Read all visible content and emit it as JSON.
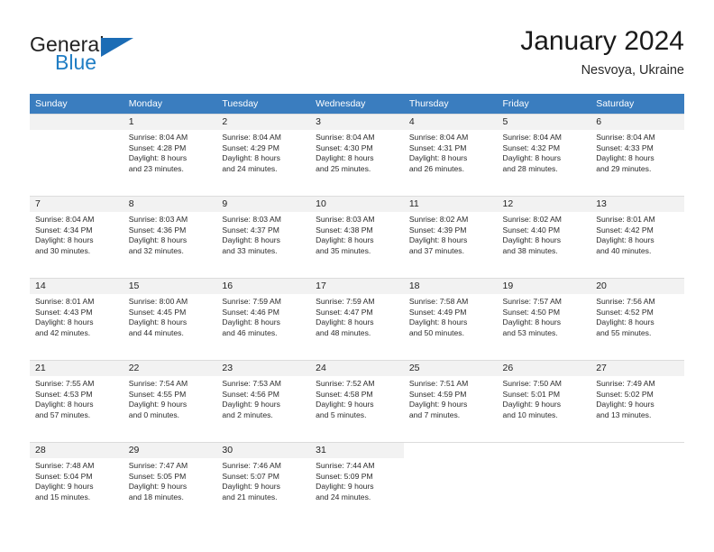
{
  "brand": {
    "name_top": "General",
    "name_bottom": "Blue",
    "triangle_color": "#1b6cb5",
    "blue_color": "#1f7dc4"
  },
  "header": {
    "title": "January 2024",
    "subtitle": "Nesvoya, Ukraine"
  },
  "theme": {
    "header_row_bg": "#3a7dbf",
    "daynum_bg": "#f2f2f2",
    "grid_line": "#dcdcdc",
    "text": "#2b2b2b"
  },
  "weekdays": [
    "Sunday",
    "Monday",
    "Tuesday",
    "Wednesday",
    "Thursday",
    "Friday",
    "Saturday"
  ],
  "labels": {
    "sunrise_prefix": "Sunrise:",
    "sunset_prefix": "Sunset:",
    "daylight_prefix": "Daylight:"
  },
  "weeks": [
    [
      {
        "empty": true
      },
      {
        "day": "1",
        "sunrise": "Sunrise: 8:04 AM",
        "sunset": "Sunset: 4:28 PM",
        "daylight_line1": "Daylight: 8 hours",
        "daylight_line2": "and 23 minutes."
      },
      {
        "day": "2",
        "sunrise": "Sunrise: 8:04 AM",
        "sunset": "Sunset: 4:29 PM",
        "daylight_line1": "Daylight: 8 hours",
        "daylight_line2": "and 24 minutes."
      },
      {
        "day": "3",
        "sunrise": "Sunrise: 8:04 AM",
        "sunset": "Sunset: 4:30 PM",
        "daylight_line1": "Daylight: 8 hours",
        "daylight_line2": "and 25 minutes."
      },
      {
        "day": "4",
        "sunrise": "Sunrise: 8:04 AM",
        "sunset": "Sunset: 4:31 PM",
        "daylight_line1": "Daylight: 8 hours",
        "daylight_line2": "and 26 minutes."
      },
      {
        "day": "5",
        "sunrise": "Sunrise: 8:04 AM",
        "sunset": "Sunset: 4:32 PM",
        "daylight_line1": "Daylight: 8 hours",
        "daylight_line2": "and 28 minutes."
      },
      {
        "day": "6",
        "sunrise": "Sunrise: 8:04 AM",
        "sunset": "Sunset: 4:33 PM",
        "daylight_line1": "Daylight: 8 hours",
        "daylight_line2": "and 29 minutes."
      }
    ],
    [
      {
        "day": "7",
        "sunrise": "Sunrise: 8:04 AM",
        "sunset": "Sunset: 4:34 PM",
        "daylight_line1": "Daylight: 8 hours",
        "daylight_line2": "and 30 minutes."
      },
      {
        "day": "8",
        "sunrise": "Sunrise: 8:03 AM",
        "sunset": "Sunset: 4:36 PM",
        "daylight_line1": "Daylight: 8 hours",
        "daylight_line2": "and 32 minutes."
      },
      {
        "day": "9",
        "sunrise": "Sunrise: 8:03 AM",
        "sunset": "Sunset: 4:37 PM",
        "daylight_line1": "Daylight: 8 hours",
        "daylight_line2": "and 33 minutes."
      },
      {
        "day": "10",
        "sunrise": "Sunrise: 8:03 AM",
        "sunset": "Sunset: 4:38 PM",
        "daylight_line1": "Daylight: 8 hours",
        "daylight_line2": "and 35 minutes."
      },
      {
        "day": "11",
        "sunrise": "Sunrise: 8:02 AM",
        "sunset": "Sunset: 4:39 PM",
        "daylight_line1": "Daylight: 8 hours",
        "daylight_line2": "and 37 minutes."
      },
      {
        "day": "12",
        "sunrise": "Sunrise: 8:02 AM",
        "sunset": "Sunset: 4:40 PM",
        "daylight_line1": "Daylight: 8 hours",
        "daylight_line2": "and 38 minutes."
      },
      {
        "day": "13",
        "sunrise": "Sunrise: 8:01 AM",
        "sunset": "Sunset: 4:42 PM",
        "daylight_line1": "Daylight: 8 hours",
        "daylight_line2": "and 40 minutes."
      }
    ],
    [
      {
        "day": "14",
        "sunrise": "Sunrise: 8:01 AM",
        "sunset": "Sunset: 4:43 PM",
        "daylight_line1": "Daylight: 8 hours",
        "daylight_line2": "and 42 minutes."
      },
      {
        "day": "15",
        "sunrise": "Sunrise: 8:00 AM",
        "sunset": "Sunset: 4:45 PM",
        "daylight_line1": "Daylight: 8 hours",
        "daylight_line2": "and 44 minutes."
      },
      {
        "day": "16",
        "sunrise": "Sunrise: 7:59 AM",
        "sunset": "Sunset: 4:46 PM",
        "daylight_line1": "Daylight: 8 hours",
        "daylight_line2": "and 46 minutes."
      },
      {
        "day": "17",
        "sunrise": "Sunrise: 7:59 AM",
        "sunset": "Sunset: 4:47 PM",
        "daylight_line1": "Daylight: 8 hours",
        "daylight_line2": "and 48 minutes."
      },
      {
        "day": "18",
        "sunrise": "Sunrise: 7:58 AM",
        "sunset": "Sunset: 4:49 PM",
        "daylight_line1": "Daylight: 8 hours",
        "daylight_line2": "and 50 minutes."
      },
      {
        "day": "19",
        "sunrise": "Sunrise: 7:57 AM",
        "sunset": "Sunset: 4:50 PM",
        "daylight_line1": "Daylight: 8 hours",
        "daylight_line2": "and 53 minutes."
      },
      {
        "day": "20",
        "sunrise": "Sunrise: 7:56 AM",
        "sunset": "Sunset: 4:52 PM",
        "daylight_line1": "Daylight: 8 hours",
        "daylight_line2": "and 55 minutes."
      }
    ],
    [
      {
        "day": "21",
        "sunrise": "Sunrise: 7:55 AM",
        "sunset": "Sunset: 4:53 PM",
        "daylight_line1": "Daylight: 8 hours",
        "daylight_line2": "and 57 minutes."
      },
      {
        "day": "22",
        "sunrise": "Sunrise: 7:54 AM",
        "sunset": "Sunset: 4:55 PM",
        "daylight_line1": "Daylight: 9 hours",
        "daylight_line2": "and 0 minutes."
      },
      {
        "day": "23",
        "sunrise": "Sunrise: 7:53 AM",
        "sunset": "Sunset: 4:56 PM",
        "daylight_line1": "Daylight: 9 hours",
        "daylight_line2": "and 2 minutes."
      },
      {
        "day": "24",
        "sunrise": "Sunrise: 7:52 AM",
        "sunset": "Sunset: 4:58 PM",
        "daylight_line1": "Daylight: 9 hours",
        "daylight_line2": "and 5 minutes."
      },
      {
        "day": "25",
        "sunrise": "Sunrise: 7:51 AM",
        "sunset": "Sunset: 4:59 PM",
        "daylight_line1": "Daylight: 9 hours",
        "daylight_line2": "and 7 minutes."
      },
      {
        "day": "26",
        "sunrise": "Sunrise: 7:50 AM",
        "sunset": "Sunset: 5:01 PM",
        "daylight_line1": "Daylight: 9 hours",
        "daylight_line2": "and 10 minutes."
      },
      {
        "day": "27",
        "sunrise": "Sunrise: 7:49 AM",
        "sunset": "Sunset: 5:02 PM",
        "daylight_line1": "Daylight: 9 hours",
        "daylight_line2": "and 13 minutes."
      }
    ],
    [
      {
        "day": "28",
        "sunrise": "Sunrise: 7:48 AM",
        "sunset": "Sunset: 5:04 PM",
        "daylight_line1": "Daylight: 9 hours",
        "daylight_line2": "and 15 minutes."
      },
      {
        "day": "29",
        "sunrise": "Sunrise: 7:47 AM",
        "sunset": "Sunset: 5:05 PM",
        "daylight_line1": "Daylight: 9 hours",
        "daylight_line2": "and 18 minutes."
      },
      {
        "day": "30",
        "sunrise": "Sunrise: 7:46 AM",
        "sunset": "Sunset: 5:07 PM",
        "daylight_line1": "Daylight: 9 hours",
        "daylight_line2": "and 21 minutes."
      },
      {
        "day": "31",
        "sunrise": "Sunrise: 7:44 AM",
        "sunset": "Sunset: 5:09 PM",
        "daylight_line1": "Daylight: 9 hours",
        "daylight_line2": "and 24 minutes."
      },
      {
        "blank": true
      },
      {
        "blank": true
      },
      {
        "blank": true
      }
    ]
  ]
}
